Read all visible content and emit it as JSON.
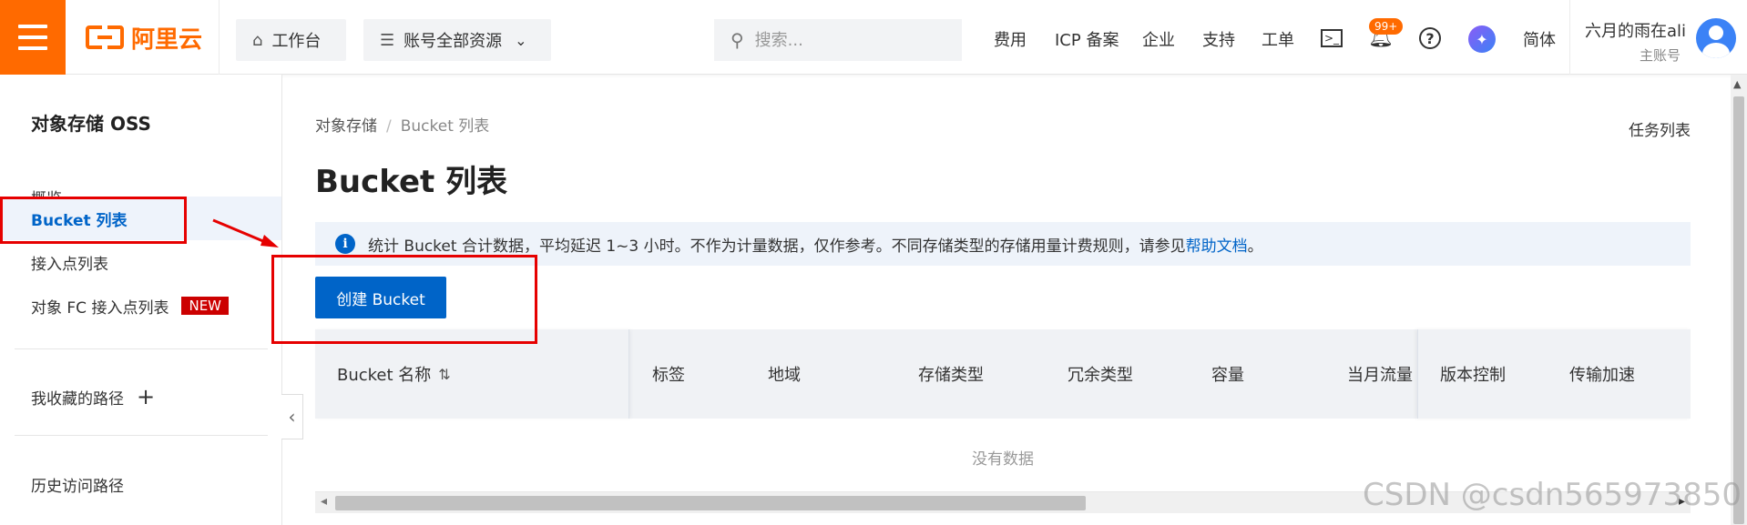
{
  "header": {
    "logo_text": "阿里云",
    "workbench_label": "工作台",
    "resources_label": "账号全部资源",
    "search_placeholder": "搜索...",
    "nav": [
      "费用",
      "ICP 备案",
      "企业",
      "支持",
      "工单"
    ],
    "notifications_badge": "99+",
    "lang_label": "简体",
    "user_name": "六月的雨在ali",
    "user_role": "主账号",
    "accent_color": "#ff6a00"
  },
  "sidebar": {
    "title": "对象存储 OSS",
    "items": [
      {
        "label": "概览"
      },
      {
        "label": "Bucket 列表"
      },
      {
        "label": "接入点列表"
      },
      {
        "label": "对象 FC 接入点列表",
        "badge": "NEW"
      }
    ],
    "favorites_label": "我收藏的路径",
    "history_label": "历史访问路径"
  },
  "main": {
    "breadcrumb": [
      "对象存储",
      "Bucket 列表"
    ],
    "task_list_label": "任务列表",
    "page_title": "Bucket 列表",
    "notice_text": "统计 Bucket 合计数据，平均延迟 1~3 小时。不作为计量数据，仅作参考。不同存储类型的存储用量计费规则，请参见",
    "notice_link": "帮助文档",
    "notice_end": "。",
    "create_button_label": "创建 Bucket",
    "table": {
      "columns": [
        "Bucket 名称",
        "标签",
        "地域",
        "存储类型",
        "冗余类型",
        "容量",
        "当月流量",
        "版本控制",
        "传输加速"
      ],
      "empty_text": "没有数据"
    },
    "primary_color": "#0064c8"
  },
  "watermark": "CSDN @csdn565973850"
}
